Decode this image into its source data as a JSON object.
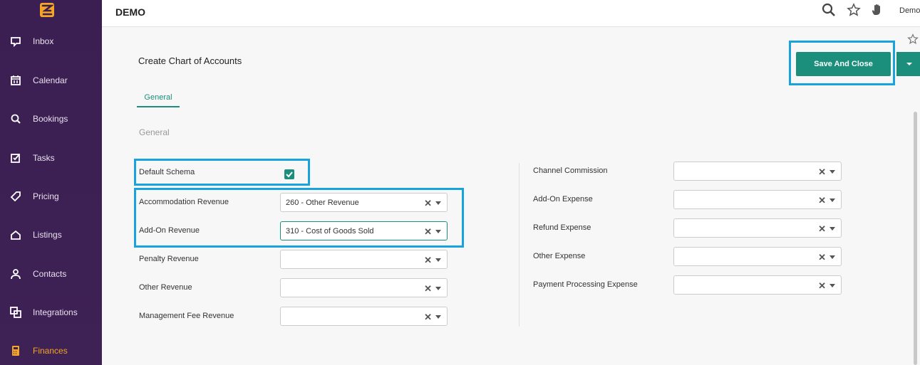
{
  "app": {
    "brand": "DEMO",
    "user": "Demo"
  },
  "sidebar": {
    "items": [
      {
        "label": "Inbox",
        "icon": "inbox-icon"
      },
      {
        "label": "Calendar",
        "icon": "calendar-icon"
      },
      {
        "label": "Bookings",
        "icon": "bookings-icon"
      },
      {
        "label": "Tasks",
        "icon": "tasks-icon"
      },
      {
        "label": "Pricing",
        "icon": "tag-icon"
      },
      {
        "label": "Listings",
        "icon": "home-icon"
      },
      {
        "label": "Contacts",
        "icon": "person-icon"
      },
      {
        "label": "Integrations",
        "icon": "integrations-icon"
      },
      {
        "label": "Finances",
        "icon": "calculator-icon"
      }
    ],
    "active": "Finances"
  },
  "page": {
    "title": "Create Chart of Accounts",
    "save_label": "Save And Close",
    "tab": "General",
    "section": "General"
  },
  "form": {
    "default_schema": {
      "label": "Default Schema",
      "checked": true
    },
    "left": [
      {
        "label": "Accommodation Revenue",
        "value": "260 - Other Revenue"
      },
      {
        "label": "Add-On Revenue",
        "value": "310 - Cost of Goods Sold"
      },
      {
        "label": "Penalty Revenue",
        "value": ""
      },
      {
        "label": "Other Revenue",
        "value": ""
      },
      {
        "label": "Management Fee Revenue",
        "value": ""
      }
    ],
    "right": [
      {
        "label": "Channel Commission",
        "value": ""
      },
      {
        "label": "Add-On Expense",
        "value": ""
      },
      {
        "label": "Refund Expense",
        "value": ""
      },
      {
        "label": "Other Expense",
        "value": ""
      },
      {
        "label": "Payment Processing Expense",
        "value": ""
      }
    ]
  },
  "colors": {
    "accent": "#1b8f7b",
    "sidebar": "#3b1f52",
    "highlight": "#19a3dd",
    "active_nav": "#f5a623"
  }
}
